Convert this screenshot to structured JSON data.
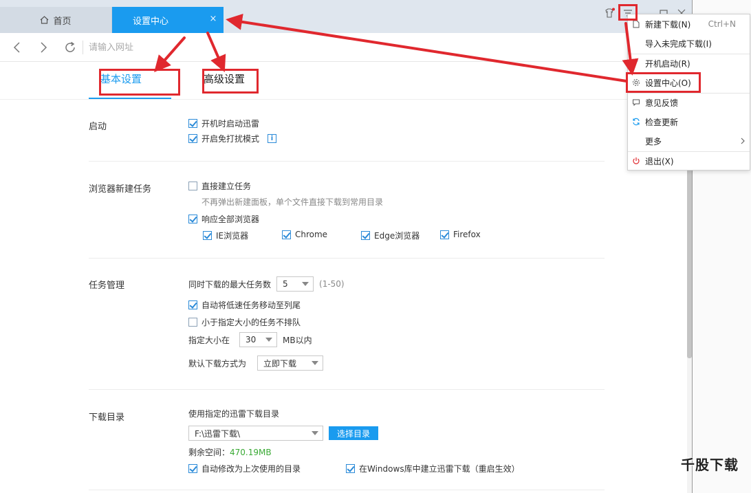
{
  "tabs": {
    "home_label": "首页",
    "settings_label": "设置中心",
    "close_glyph": "×"
  },
  "address": {
    "placeholder": "请输入网址"
  },
  "settings_tabs": {
    "basic": "基本设置",
    "advanced": "高级设置"
  },
  "startup": {
    "title": "启动",
    "auto_start": "开机时启动迅雷",
    "no_disturb": "开启免打扰模式",
    "info_glyph": "i"
  },
  "browser": {
    "title": "浏览器新建任务",
    "direct_create": "直接建立任务",
    "direct_hint": "不再弹出新建面板，单个文件直接下载到常用目录",
    "respond_all": "响应全部浏览器",
    "browsers": [
      "IE浏览器",
      "Chrome",
      "Edge浏览器",
      "Firefox"
    ]
  },
  "tasks": {
    "title": "任务管理",
    "max_label": "同时下载的最大任务数",
    "max_value": "5",
    "max_range": "(1-50)",
    "move_slow": "自动将低速任务移动至列尾",
    "small_no_queue": "小于指定大小的任务不排队",
    "size_label": "指定大小在",
    "size_value": "30",
    "size_unit": "MB以内",
    "mode_label": "默认下载方式为",
    "mode_value": "立即下载"
  },
  "download_dir": {
    "title": "下载目录",
    "use_label": "使用指定的迅雷下载目录",
    "path": "F:\\迅雷下载\\",
    "choose_button": "选择目录",
    "free_label": "剩余空间：",
    "free_value": "470.19MB",
    "auto_modify": "自动修改为上次使用的目录",
    "windows_lib": "在Windows库中建立迅雷下载（重启生效）"
  },
  "menu": {
    "new_download": "新建下载(N)",
    "new_shortcut": "Ctrl+N",
    "import_unfinished": "导入未完成下载(I)",
    "auto_start": "开机启动(R)",
    "settings_center": "设置中心(O)",
    "feedback": "意见反馈",
    "check_update": "检查更新",
    "more": "更多",
    "exit": "退出(X)"
  },
  "watermark": "千股下载",
  "colors": {
    "accent": "#1a9bef",
    "highlight": "#e0282e",
    "free_space": "#3aaa35"
  }
}
